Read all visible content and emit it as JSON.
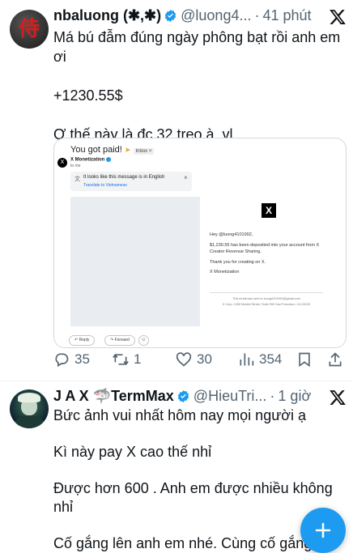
{
  "tweets": [
    {
      "display_name": "nbaluong (✱,✱)",
      "handle": "@luong4...",
      "time": "41 phút",
      "text": "Má bú đẫm đúng ngày phông bạt rồi anh em ơi\n\n+1230.55$\n\nƠ thế này là đc 32 trẹo à, vl",
      "avatar_glyph": "侍",
      "actions": {
        "replies": "35",
        "retweets": "1",
        "likes": "30",
        "views": "354"
      }
    },
    {
      "display_name": "J A X 🦈TermMax",
      "handle": "@HieuTri...",
      "time": "1 giờ",
      "text": "Bức ảnh vui nhất hôm nay mọi người ạ\n\nKì này pay X cao thế nhỉ\n\nĐược hơn 600 . Anh em được nhiều không nhỉ\n\nCố gắng lên anh em nhé. Cùng cố gắng"
    }
  ],
  "email": {
    "subject": "You got paid!",
    "inbox_tag": "Inbox ×",
    "sender": "X Monetization",
    "to": "to me",
    "translate_notice": "It looks like this message is in English",
    "translate_link": "Translate to Vietnamese",
    "greeting": "Hey @luong4101992,",
    "paragraph": "$1,230.55 has been deposited into your account from X Creator Revenue Sharing.",
    "thanks": "Thank you for creating on X.",
    "signature": "X Monetization",
    "footer1": "This email was sent to luong4101992@gmail.com",
    "footer2": "X Corp. 1355 Market Street, Suite 900 San Francisco, CA 94103",
    "reply_label": "Reply",
    "forward_label": "Forward"
  },
  "colors": {
    "accent": "#1d9bf0",
    "text": "#0f1419",
    "muted": "#536471"
  },
  "icons": {
    "reply": "speech-bubble",
    "retweet": "retweet-arrows",
    "like": "heart",
    "views": "bar-chart",
    "bookmark": "bookmark",
    "share": "share-upload",
    "close": "x-logo",
    "compose": "plus"
  }
}
